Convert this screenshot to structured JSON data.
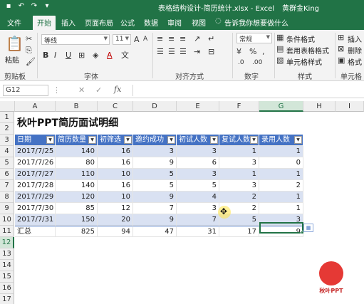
{
  "window": {
    "title": "表格结构设计-简历统计.xlsx - Excel",
    "user": "黄群金King"
  },
  "tabs": [
    "文件",
    "开始",
    "插入",
    "页面布局",
    "公式",
    "数据",
    "审阅",
    "视图"
  ],
  "tell_me": "告诉我你想要做什么",
  "ribbon": {
    "paste": "粘贴",
    "clipboard": "剪贴板",
    "font_name": "等线",
    "font_size": "11",
    "font_group": "字体",
    "align_group": "对齐方式",
    "number_format": "常规",
    "number_group": "数字",
    "cond_format": "条件格式",
    "table_format": "套用表格格式",
    "cell_style": "单元格样式",
    "style_group": "样式",
    "insert": "插入",
    "delete": "删除",
    "format": "格式",
    "cells_group": "单元格"
  },
  "formula_bar": {
    "name_box": "G12",
    "fx": "fx"
  },
  "columns": [
    "A",
    "B",
    "C",
    "D",
    "E",
    "F",
    "G",
    "H",
    "I"
  ],
  "rows": [
    "1",
    "2",
    "3",
    "4",
    "5",
    "6",
    "7",
    "8",
    "9",
    "10",
    "11",
    "12",
    "13",
    "14",
    "15",
    "16",
    "17"
  ],
  "sheet": {
    "title": "秋叶PPT简历面试明细",
    "headers": [
      "日期",
      "简历数量",
      "初筛选",
      "邀约成功",
      "初试人数",
      "复试人数",
      "录用人数"
    ],
    "data": [
      [
        "2017/7/25",
        "140",
        "16",
        "3",
        "3",
        "1",
        "1"
      ],
      [
        "2017/7/26",
        "80",
        "16",
        "9",
        "6",
        "3",
        "0"
      ],
      [
        "2017/7/27",
        "110",
        "10",
        "5",
        "3",
        "1",
        "1"
      ],
      [
        "2017/7/28",
        "140",
        "16",
        "5",
        "5",
        "3",
        "2"
      ],
      [
        "2017/7/29",
        "120",
        "10",
        "9",
        "4",
        "2",
        "1"
      ],
      [
        "2017/7/30",
        "85",
        "12",
        "7",
        "3",
        "2",
        "1"
      ],
      [
        "2017/7/31",
        "150",
        "20",
        "9",
        "7",
        "5",
        "3"
      ]
    ],
    "total": [
      "汇总",
      "825",
      "94",
      "47",
      "31",
      "17",
      "9"
    ]
  },
  "logo_text": "秋叶PPT"
}
